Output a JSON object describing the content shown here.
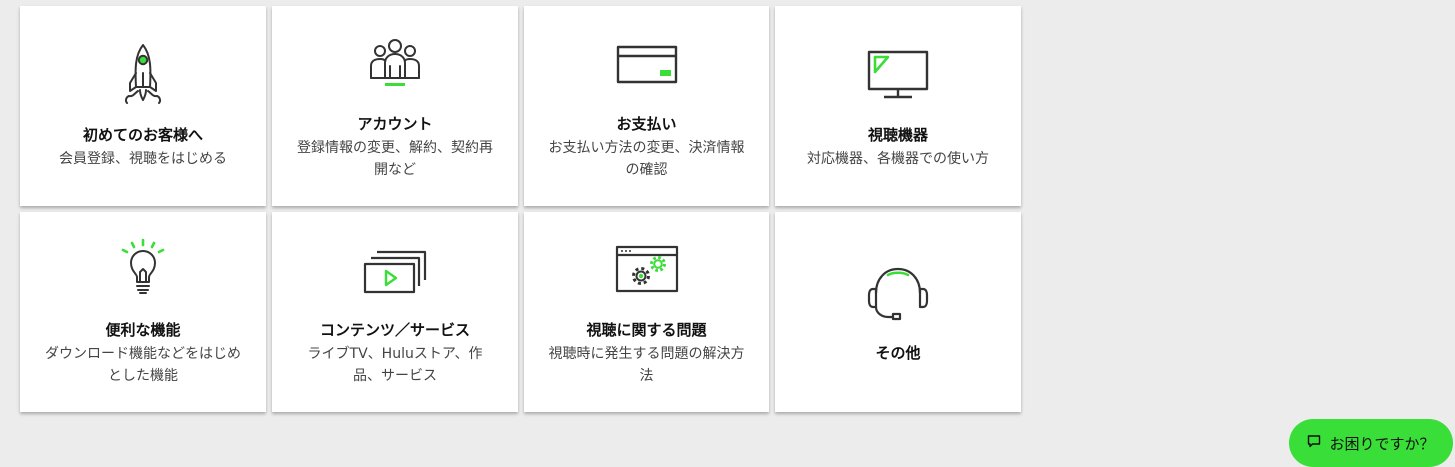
{
  "colors": {
    "background": "#ebeceb",
    "card": "#ffffff",
    "accent": "#3ade38",
    "icon_stroke": "#333333"
  },
  "categories": [
    {
      "title": "初めてのお客様へ",
      "description": "会員登録、視聴をはじめる",
      "icon": "rocket-icon"
    },
    {
      "title": "アカウント",
      "description": "登録情報の変更、解約、契約再開など",
      "icon": "people-icon"
    },
    {
      "title": "お支払い",
      "description": "お支払い方法の変更、決済情報の確認",
      "icon": "credit-card-icon"
    },
    {
      "title": "視聴機器",
      "description": "対応機器、各機器での使い方",
      "icon": "monitor-icon"
    },
    {
      "title": "便利な機能",
      "description": "ダウンロード機能などをはじめとした機能",
      "icon": "lightbulb-icon"
    },
    {
      "title": "コンテンツ／サービス",
      "description": "ライブTV、Huluストア、作品、サービス",
      "icon": "video-stack-icon"
    },
    {
      "title": "視聴に関する問題",
      "description": "視聴時に発生する問題の解決方法",
      "icon": "settings-window-icon"
    },
    {
      "title": "その他",
      "description": "",
      "icon": "headset-icon"
    }
  ],
  "help_button": {
    "label": "お困りですか？",
    "icon": "chat-icon"
  }
}
